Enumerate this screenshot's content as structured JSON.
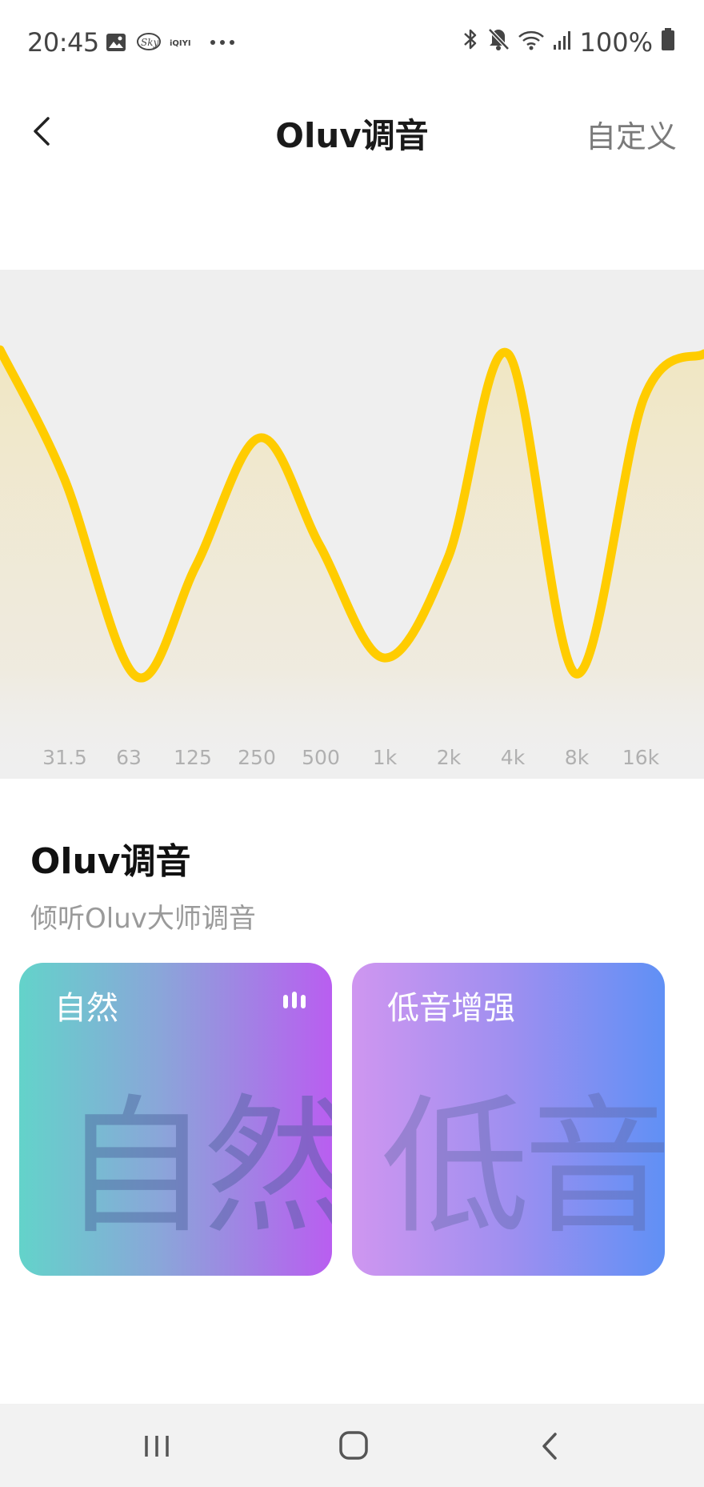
{
  "status_bar": {
    "time": "20:45",
    "battery": "100%"
  },
  "header": {
    "title": "Oluv调音",
    "action_label": "自定义"
  },
  "equalizer": {
    "line_color": "#ffcc00",
    "bands": [
      {
        "label": "31.5"
      },
      {
        "label": "63"
      },
      {
        "label": "125"
      },
      {
        "label": "250"
      },
      {
        "label": "500"
      },
      {
        "label": "1k"
      },
      {
        "label": "2k"
      },
      {
        "label": "4k"
      },
      {
        "label": "8k"
      },
      {
        "label": "16k"
      }
    ]
  },
  "section": {
    "title": "Oluv调音",
    "subtitle": "倾听Oluv大师调音"
  },
  "presets": [
    {
      "label": "自然",
      "watermark": "自然",
      "active": true
    },
    {
      "label": "低音增强",
      "watermark": "低音",
      "active": false
    }
  ],
  "icons": {
    "back": "chevron-left-icon",
    "nav_recent": "recent-apps-icon",
    "nav_home": "home-icon",
    "nav_back": "nav-back-icon"
  }
}
